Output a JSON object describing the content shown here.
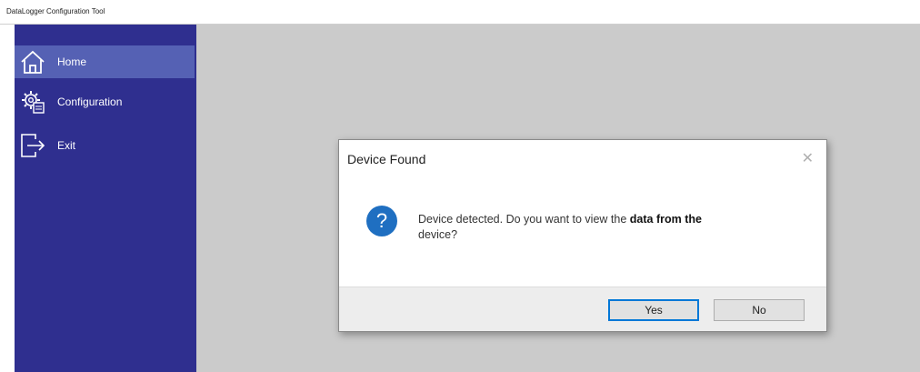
{
  "window": {
    "title": "DataLogger Configuration Tool"
  },
  "sidebar": {
    "items": [
      {
        "label": "Home",
        "icon": "home-icon",
        "selected": true
      },
      {
        "label": "Configuration",
        "icon": "gear-icon",
        "selected": false
      },
      {
        "label": "Exit",
        "icon": "exit-icon",
        "selected": false
      }
    ]
  },
  "dialog": {
    "title": "Device Found",
    "close_symbol": "✕",
    "icon": "question-icon",
    "icon_glyph": "?",
    "message_part1": "Device detected. Do you want to view the ",
    "message_bold": "data from the",
    "message_part2": "device?",
    "yes_label": "Yes",
    "no_label": "No"
  },
  "colors": {
    "sidebar": "#2f2f8f",
    "sidebar_selected": "#5561b4",
    "content_bg": "#cbcbcb",
    "accent": "#0078d7",
    "question_icon": "#1f6fc1"
  }
}
